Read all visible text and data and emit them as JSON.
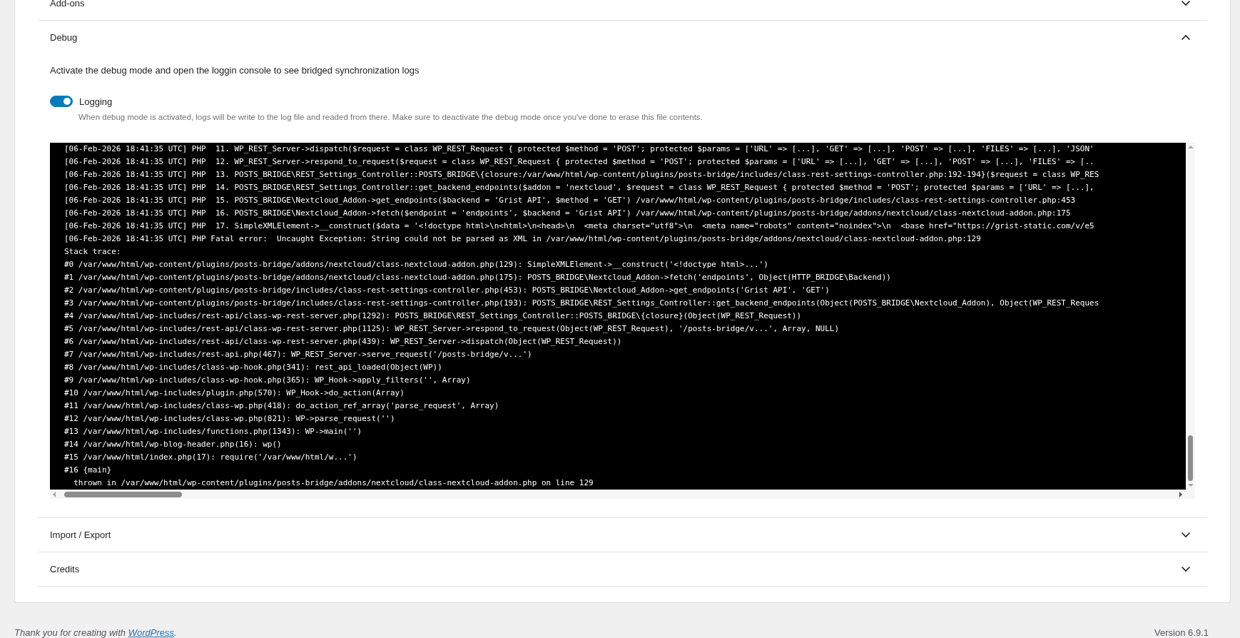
{
  "sections": [
    {
      "title": "Add-ons",
      "expanded": false
    },
    {
      "title": "Debug",
      "expanded": true,
      "content": {
        "description": "Activate the debug mode and open the loggin console to see bridged synchronization logs",
        "toggle": {
          "label": "Logging",
          "checked": true
        },
        "help": "When debug mode is activated, logs will be write to the log file and readed from there. Make sure to deactivate the debug mode once you've done to erase this file contents.",
        "log_lines": [
          "[06-Feb-2026 18:41:35 UTC] PHP  11. WP_REST_Server->dispatch($request = class WP_REST_Request { protected $method = 'POST'; protected $params = ['URL' => [...], 'GET' => [...], 'POST' => [...], 'FILES' => [...], 'JSON'",
          "[06-Feb-2026 18:41:35 UTC] PHP  12. WP_REST_Server->respond_to_request($request = class WP_REST_Request { protected $method = 'POST'; protected $params = ['URL' => [...], 'GET' => [...], 'POST' => [...], 'FILES' => [..",
          "[06-Feb-2026 18:41:35 UTC] PHP  13. POSTS_BRIDGE\\REST_Settings_Controller::POSTS_BRIDGE\\{closure:/var/www/html/wp-content/plugins/posts-bridge/includes/class-rest-settings-controller.php:192-194}($request = class WP_RES",
          "[06-Feb-2026 18:41:35 UTC] PHP  14. POSTS_BRIDGE\\REST_Settings_Controller::get_backend_endpoints($addon = 'nextcloud', $request = class WP_REST_Request { protected $method = 'POST'; protected $params = ['URL' => [...],",
          "[06-Feb-2026 18:41:35 UTC] PHP  15. POSTS_BRIDGE\\Nextcloud_Addon->get_endpoints($backend = 'Grist API', $method = 'GET') /var/www/html/wp-content/plugins/posts-bridge/includes/class-rest-settings-controller.php:453",
          "[06-Feb-2026 18:41:35 UTC] PHP  16. POSTS_BRIDGE\\Nextcloud_Addon->fetch($endpoint = 'endpoints', $backend = 'Grist API') /var/www/html/wp-content/plugins/posts-bridge/addons/nextcloud/class-nextcloud-addon.php:175",
          "[06-Feb-2026 18:41:35 UTC] PHP  17. SimpleXMLElement->__construct($data = '<!doctype html>\\n<html>\\n<head>\\n  <meta charset=\"utf8\">\\n  <meta name=\"robots\" content=\"noindex\">\\n  <base href=\"https://grist-static.com/v/e5",
          "[06-Feb-2026 18:41:35 UTC] PHP Fatal error:  Uncaught Exception: String could not be parsed as XML in /var/www/html/wp-content/plugins/posts-bridge/addons/nextcloud/class-nextcloud-addon.php:129",
          "Stack trace:",
          "#0 /var/www/html/wp-content/plugins/posts-bridge/addons/nextcloud/class-nextcloud-addon.php(129): SimpleXMLElement->__construct('<!doctype html>...')",
          "#1 /var/www/html/wp-content/plugins/posts-bridge/addons/nextcloud/class-nextcloud-addon.php(175): POSTS_BRIDGE\\Nextcloud_Addon->fetch('endpoints', Object(HTTP_BRIDGE\\Backend))",
          "#2 /var/www/html/wp-content/plugins/posts-bridge/includes/class-rest-settings-controller.php(453): POSTS_BRIDGE\\Nextcloud_Addon->get_endpoints('Grist API', 'GET')",
          "#3 /var/www/html/wp-content/plugins/posts-bridge/includes/class-rest-settings-controller.php(193): POSTS_BRIDGE\\REST_Settings_Controller::get_backend_endpoints(Object(POSTS_BRIDGE\\Nextcloud_Addon), Object(WP_REST_Reques",
          "#4 /var/www/html/wp-includes/rest-api/class-wp-rest-server.php(1292): POSTS_BRIDGE\\REST_Settings_Controller::POSTS_BRIDGE\\{closure}(Object(WP_REST_Request))",
          "#5 /var/www/html/wp-includes/rest-api/class-wp-rest-server.php(1125): WP_REST_Server->respond_to_request(Object(WP_REST_Request), '/posts-bridge/v...', Array, NULL)",
          "#6 /var/www/html/wp-includes/rest-api/class-wp-rest-server.php(439): WP_REST_Server->dispatch(Object(WP_REST_Request))",
          "#7 /var/www/html/wp-includes/rest-api.php(467): WP_REST_Server->serve_request('/posts-bridge/v...')",
          "#8 /var/www/html/wp-includes/class-wp-hook.php(341): rest_api_loaded(Object(WP))",
          "#9 /var/www/html/wp-includes/class-wp-hook.php(365): WP_Hook->apply_filters('', Array)",
          "#10 /var/www/html/wp-includes/plugin.php(570): WP_Hook->do_action(Array)",
          "#11 /var/www/html/wp-includes/class-wp.php(418): do_action_ref_array('parse_request', Array)",
          "#12 /var/www/html/wp-includes/class-wp.php(821): WP->parse_request('')",
          "#13 /var/www/html/wp-includes/functions.php(1343): WP->main('')",
          "#14 /var/www/html/wp-blog-header.php(16): wp()",
          "#15 /var/www/html/index.php(17): require('/var/www/html/w...')",
          "#16 {main}",
          "  thrown in /var/www/html/wp-content/plugins/posts-bridge/addons/nextcloud/class-nextcloud-addon.php on line 129"
        ]
      }
    },
    {
      "title": "Import / Export",
      "expanded": false
    },
    {
      "title": "Credits",
      "expanded": false
    }
  ],
  "footer": {
    "thanks": "Thank you for creating with",
    "link": "WordPress",
    "after_link": ".",
    "version": "Version 6.9.1"
  }
}
